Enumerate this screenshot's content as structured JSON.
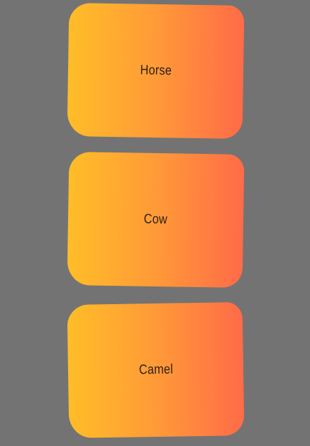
{
  "background_color": "#737373",
  "card_gradient": {
    "start_color": "#ffbd28",
    "end_color": "#ff6b48"
  },
  "cards": [
    {
      "label": "Horse"
    },
    {
      "label": "Cow"
    },
    {
      "label": "Camel"
    }
  ]
}
